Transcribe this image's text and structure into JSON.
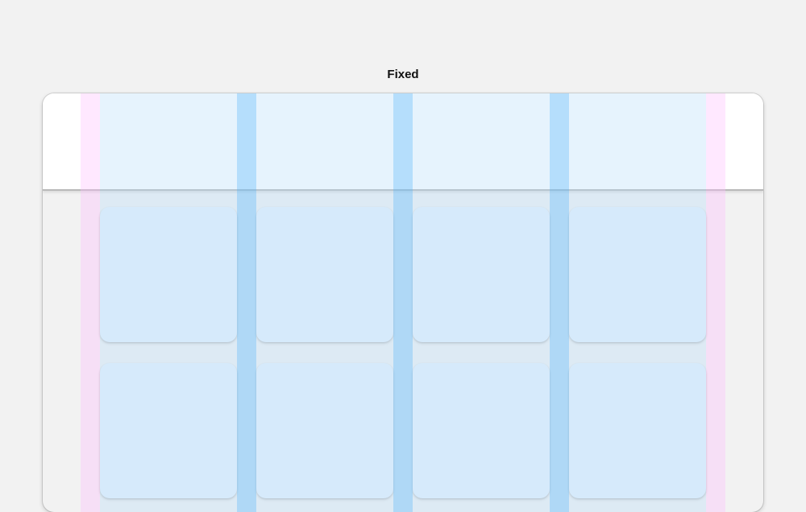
{
  "header": {
    "title": "Fixed"
  },
  "layout_overlay": {
    "columns": 4,
    "colors": {
      "margin": "#ffbeff",
      "column": "#b8defa",
      "gutter": "#78c3fa",
      "card": "#e6f2fc",
      "app_bar": "#ffffff",
      "background": "#f2f2f2"
    }
  }
}
